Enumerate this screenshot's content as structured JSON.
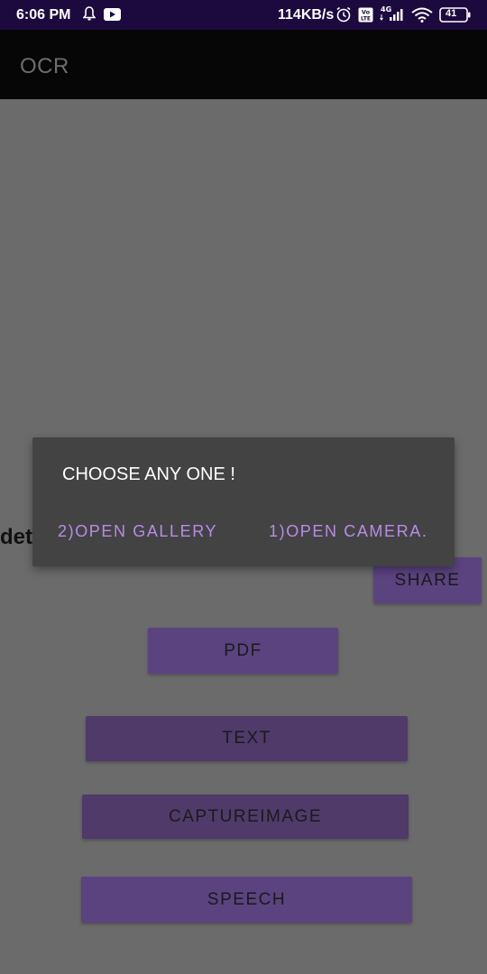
{
  "status_bar": {
    "time": "6:06 PM",
    "net_speed": "114KB/s",
    "network_type": "4G",
    "volte": "Vo LTE",
    "battery": "41",
    "icons": [
      "bell-icon",
      "youtube-icon",
      "alarm-icon",
      "volte-icon",
      "signal-icon",
      "wifi-icon",
      "battery-icon"
    ]
  },
  "app_bar": {
    "title": "OCR"
  },
  "background": {
    "partial_text": "det",
    "buttons": {
      "share": "SHARE",
      "pdf": "PDF",
      "text": "TEXT",
      "capture_image": "CAPTUREIMAGE",
      "speech": "SPEECH"
    }
  },
  "dialog": {
    "title": "CHOOSE ANY ONE !",
    "gallery_label": "2)OPEN GALLERY",
    "camera_label": "1)OPEN CAMERA."
  },
  "colors": {
    "status_bar_bg": "#1c0a3f",
    "app_bar_bg": "#060606",
    "scrim_bg": "#6b6b6b",
    "dialog_bg": "#434343",
    "dialog_accent": "#b98be8",
    "button_bg": "#5b4380"
  }
}
